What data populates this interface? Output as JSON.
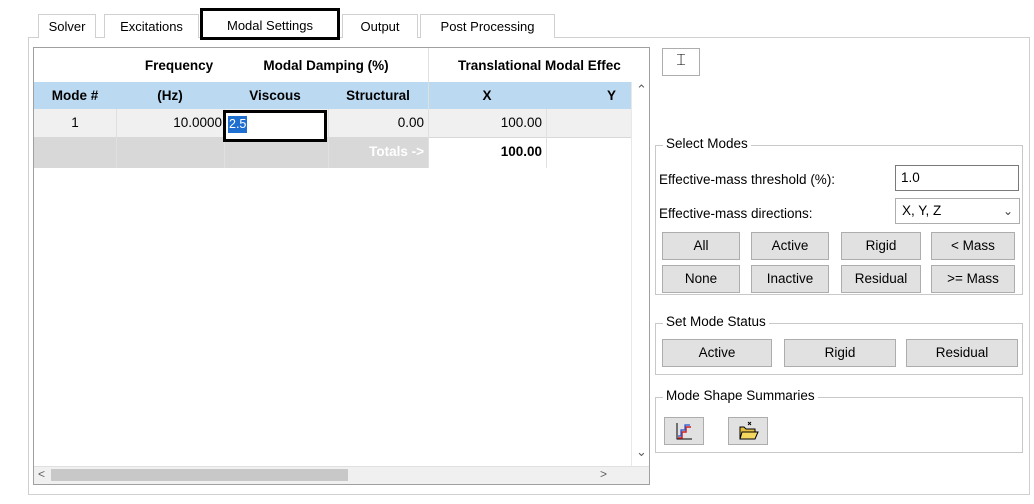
{
  "tabs": [
    {
      "label": "Solver"
    },
    {
      "label": "Excitations"
    },
    {
      "label": "Modal Settings"
    },
    {
      "label": "Output"
    },
    {
      "label": "Post Processing"
    }
  ],
  "table": {
    "header_top": {
      "frequency": "Frequency",
      "damping": "Modal Damping (%)",
      "translational": "Translational Modal Effec"
    },
    "header_bottom": {
      "mode": "Mode #",
      "hz": "(Hz)",
      "viscous": "Viscous",
      "structural": "Structural",
      "x": "X",
      "y": "Y"
    },
    "rows": [
      {
        "mode": "1",
        "frequency": "10.0000",
        "viscous": "2.5",
        "structural": "0.00",
        "x": "100.00",
        "y": ""
      }
    ],
    "totals": {
      "label": "Totals ->",
      "x": "100.00"
    }
  },
  "select_modes": {
    "title": "Select Modes",
    "threshold_label": "Effective-mass threshold (%):",
    "threshold_value": "1.0",
    "directions_label": "Effective-mass directions:",
    "directions_value": "X, Y, Z",
    "buttons_row1": [
      "All",
      "Active",
      "Rigid",
      "< Mass"
    ],
    "buttons_row2": [
      "None",
      "Inactive",
      "Residual",
      ">= Mass"
    ]
  },
  "set_mode_status": {
    "title": "Set Mode Status",
    "buttons": [
      "Active",
      "Rigid",
      "Residual"
    ]
  },
  "mode_shape_summaries": {
    "title": "Mode Shape Summaries"
  },
  "icons": {
    "pin": "pin-icon",
    "chart": "stair-chart-icon",
    "folder": "open-folder-icon"
  }
}
